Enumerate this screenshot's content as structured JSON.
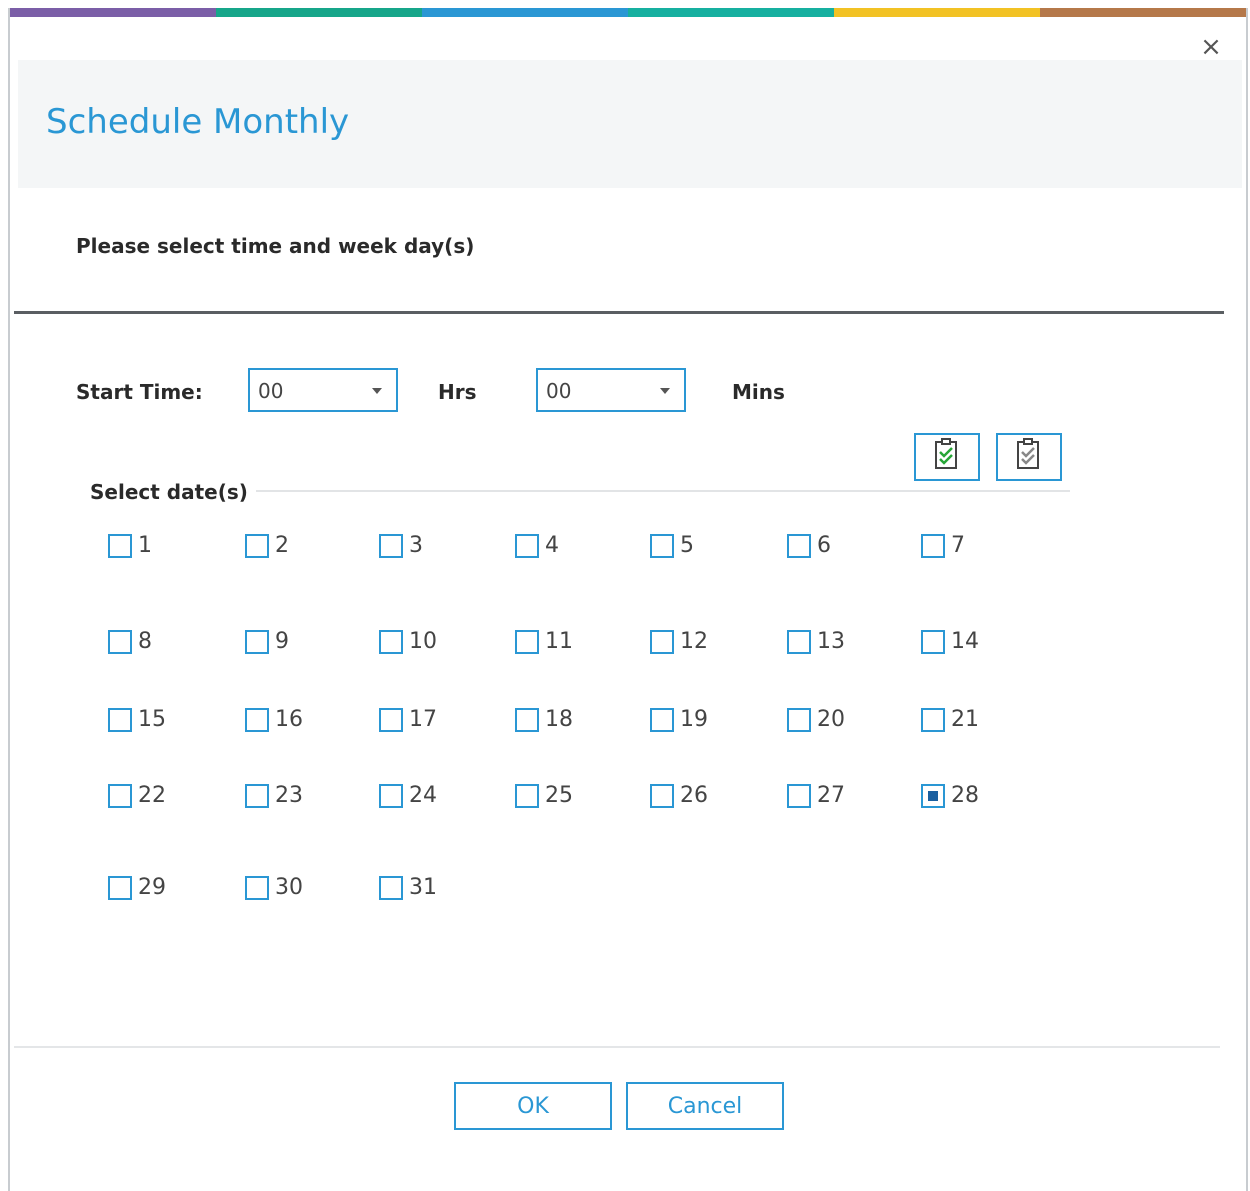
{
  "accent_colors": [
    "#7b5ea7",
    "#17a68a",
    "#2a97d4",
    "#17b0a0",
    "#f2c224",
    "#b5784a"
  ],
  "close_icon": "close-icon",
  "title": "Schedule Monthly",
  "instruction": "Please select time and week day(s)",
  "start_time": {
    "label": "Start Time:",
    "hours_value": "00",
    "hours_unit": "Hrs",
    "minutes_value": "00",
    "minutes_unit": "Mins"
  },
  "toolbar": {
    "select_all_icon": "select-all-icon",
    "deselect_all_icon": "deselect-all-icon"
  },
  "dates": {
    "group_title": "Select date(s)",
    "rows": [
      [
        {
          "n": "1",
          "c": false
        },
        {
          "n": "2",
          "c": false
        },
        {
          "n": "3",
          "c": false
        },
        {
          "n": "4",
          "c": false
        },
        {
          "n": "5",
          "c": false
        },
        {
          "n": "6",
          "c": false
        },
        {
          "n": "7",
          "c": false
        }
      ],
      [
        {
          "n": "8",
          "c": false
        },
        {
          "n": "9",
          "c": false
        },
        {
          "n": "10",
          "c": false
        },
        {
          "n": "11",
          "c": false
        },
        {
          "n": "12",
          "c": false
        },
        {
          "n": "13",
          "c": false
        },
        {
          "n": "14",
          "c": false
        }
      ],
      [
        {
          "n": "15",
          "c": false
        },
        {
          "n": "16",
          "c": false
        },
        {
          "n": "17",
          "c": false
        },
        {
          "n": "18",
          "c": false
        },
        {
          "n": "19",
          "c": false
        },
        {
          "n": "20",
          "c": false
        },
        {
          "n": "21",
          "c": false
        }
      ],
      [
        {
          "n": "22",
          "c": false
        },
        {
          "n": "23",
          "c": false
        },
        {
          "n": "24",
          "c": false
        },
        {
          "n": "25",
          "c": false
        },
        {
          "n": "26",
          "c": false
        },
        {
          "n": "27",
          "c": false
        },
        {
          "n": "28",
          "c": true
        }
      ],
      [
        {
          "n": "29",
          "c": false
        },
        {
          "n": "30",
          "c": false
        },
        {
          "n": "31",
          "c": false
        }
      ]
    ]
  },
  "buttons": {
    "ok": "OK",
    "cancel": "Cancel"
  }
}
